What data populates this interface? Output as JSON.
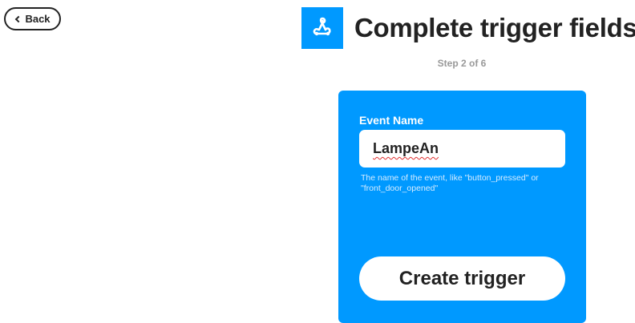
{
  "back_button": {
    "label": "Back"
  },
  "header": {
    "logo_icon": "webhook-icon",
    "title": "Complete trigger fields",
    "step": "Step 2 of 6"
  },
  "form": {
    "field_label": "Event Name",
    "field_value": "LampeAn",
    "field_help": "The name of the event, like \"button_pressed\" or \"front_door_opened\"",
    "submit_label": "Create trigger"
  },
  "colors": {
    "accent": "#0099ff",
    "text": "#222222",
    "muted": "#999999"
  }
}
